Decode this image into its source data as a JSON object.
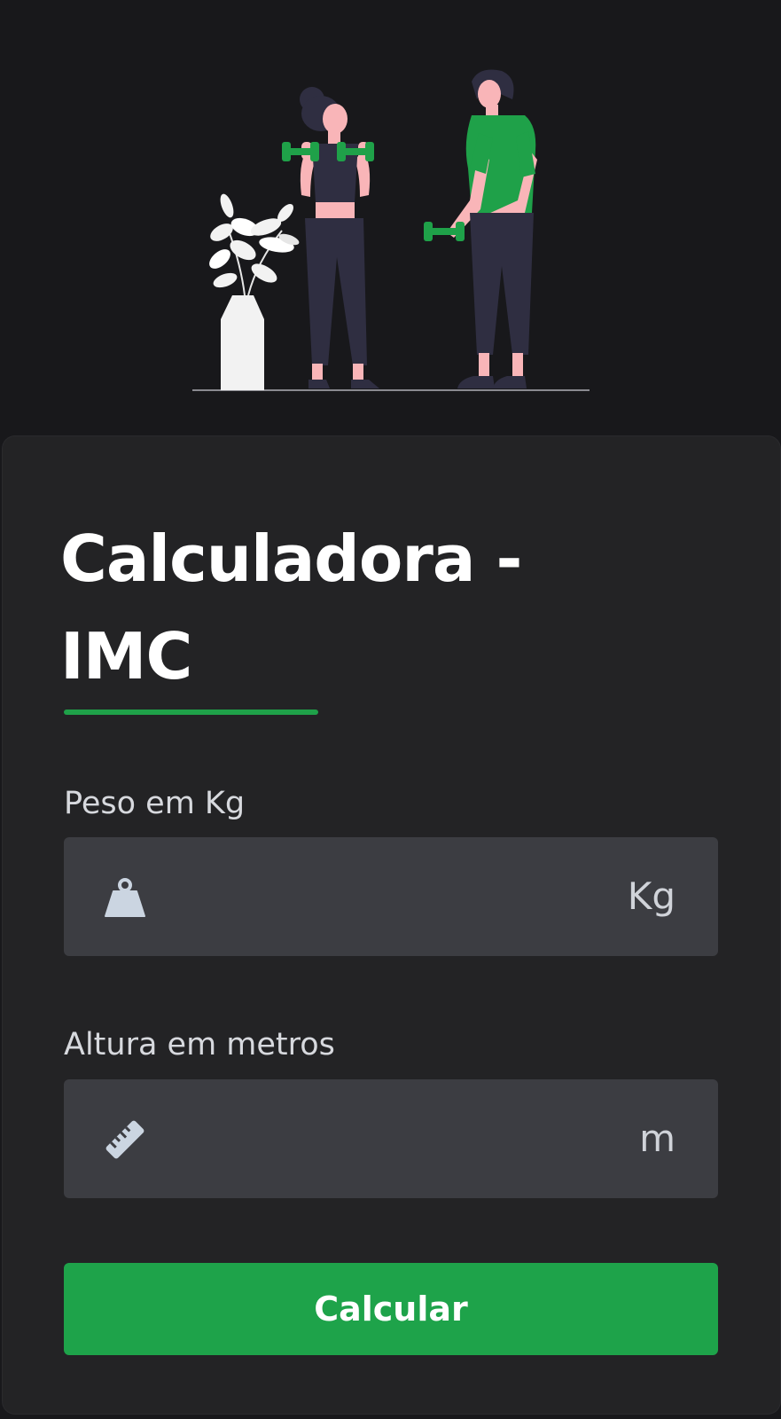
{
  "colors": {
    "background": "#18181b",
    "card": "#232325",
    "input": "#3c3d42",
    "accent": "#1ea34a",
    "skin": "#f9b5b8",
    "clothing_dark": "#2f2e41"
  },
  "hero": {
    "illustration": "fitness-illustration"
  },
  "header": {
    "title": "Calculadora - IMC"
  },
  "form": {
    "weight": {
      "label": "Peso em Kg",
      "icon": "weight-icon",
      "value": "",
      "unit": "Kg"
    },
    "height": {
      "label": "Altura em metros",
      "icon": "ruler-icon",
      "value": "",
      "unit": "m"
    },
    "submit_label": "Calcular"
  }
}
